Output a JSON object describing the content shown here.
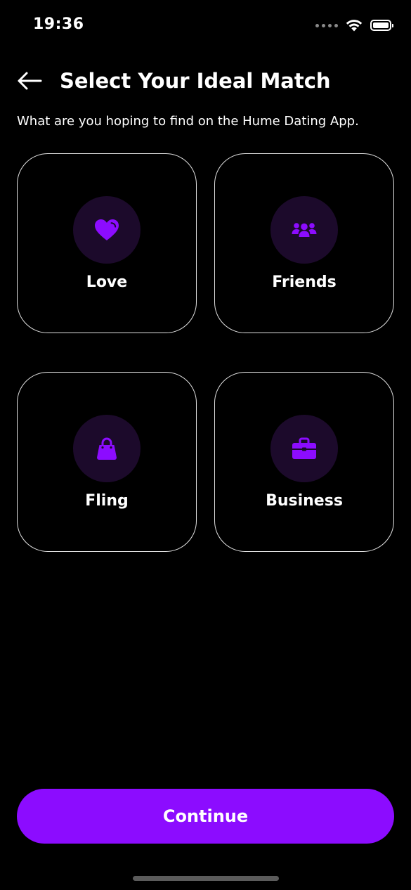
{
  "status_bar": {
    "time": "19:36",
    "icons": [
      "signal-dots-icon",
      "wifi-icon",
      "battery-icon"
    ]
  },
  "header": {
    "back_icon": "arrow-left-icon",
    "title": "Select Your Ideal Match"
  },
  "subtitle": "What are you hoping to find on the Hume Dating App.",
  "options": [
    {
      "label": "Love",
      "icon": "heart-icon"
    },
    {
      "label": "Friends",
      "icon": "group-icon"
    },
    {
      "label": "Fling",
      "icon": "handbag-icon"
    },
    {
      "label": "Business",
      "icon": "briefcase-icon"
    }
  ],
  "continue_label": "Continue",
  "colors": {
    "accent": "#8c0cff",
    "icon_circle_bg": "#1c0a2b",
    "background": "#000000",
    "card_border": "#e0e0e0"
  }
}
